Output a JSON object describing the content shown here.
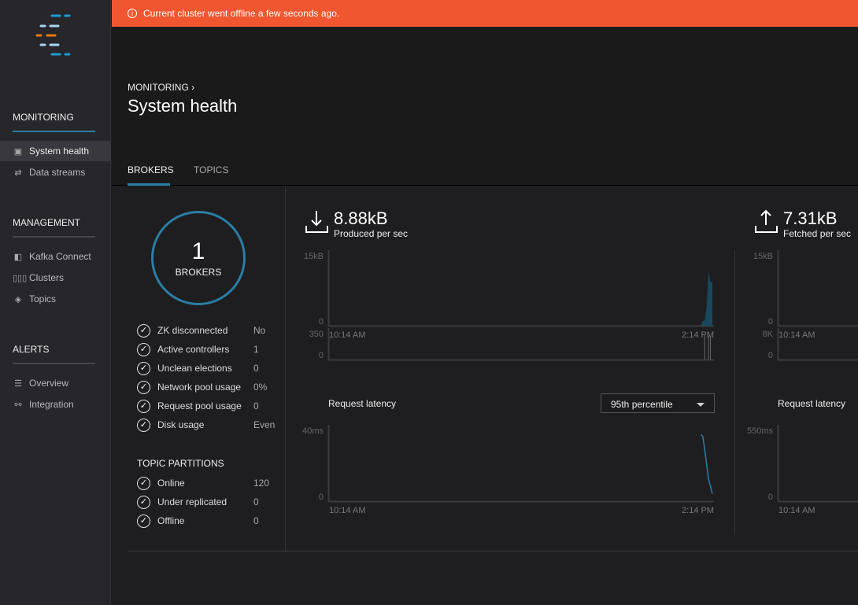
{
  "banner": {
    "text": "Current cluster went offline a few seconds ago.",
    "icon": "info-icon",
    "color": "#f0562f"
  },
  "sidebar": {
    "sections": [
      {
        "title": "MONITORING",
        "items": [
          {
            "label": "System health",
            "icon": "pulse-chart-icon",
            "active": true
          },
          {
            "label": "Data streams",
            "icon": "arrows-icon"
          }
        ]
      },
      {
        "title": "MANAGEMENT",
        "items": [
          {
            "label": "Kafka Connect",
            "icon": "connect-icon"
          },
          {
            "label": "Clusters",
            "icon": "clusters-icon"
          },
          {
            "label": "Topics",
            "icon": "layers-icon"
          }
        ]
      },
      {
        "title": "ALERTS",
        "items": [
          {
            "label": "Overview",
            "icon": "menu-icon"
          },
          {
            "label": "Integration",
            "icon": "integration-icon"
          }
        ]
      }
    ]
  },
  "header": {
    "breadcrumb": "MONITORING",
    "title": "System health"
  },
  "tabs": [
    {
      "label": "BROKERS",
      "active": true
    },
    {
      "label": "TOPICS"
    }
  ],
  "brokers": {
    "count": "1",
    "label": "BROKERS",
    "status": [
      {
        "label": "ZK disconnected",
        "value": "No"
      },
      {
        "label": "Active controllers",
        "value": "1"
      },
      {
        "label": "Unclean elections",
        "value": "0"
      },
      {
        "label": "Network pool usage",
        "value": "0%"
      },
      {
        "label": "Request pool usage",
        "value": "0"
      },
      {
        "label": "Disk usage",
        "value": "Even"
      }
    ],
    "partitions_title": "TOPIC PARTITIONS",
    "partitions": [
      {
        "label": "Online",
        "value": "120"
      },
      {
        "label": "Under replicated",
        "value": "0"
      },
      {
        "label": "Offline",
        "value": "0"
      }
    ]
  },
  "produced": {
    "value": "8.88kB",
    "label": "Produced per sec"
  },
  "fetched": {
    "value": "7.31kB",
    "label": "Fetched per sec"
  },
  "latency": {
    "label": "Request latency",
    "select": "95th percentile"
  },
  "accent": "#2a7ea5",
  "chart_data": [
    {
      "type": "area",
      "name": "produced-bytes",
      "ylim": [
        0,
        15
      ],
      "yticks": [
        "15kB",
        "0"
      ],
      "xticks": [
        "10:14 AM",
        "2:14 PM"
      ],
      "x": [
        0,
        0.97,
        0.975,
        0.98,
        0.985,
        0.99,
        0.995,
        1
      ],
      "values": [
        0,
        0,
        1,
        1,
        4,
        11,
        9,
        9
      ]
    },
    {
      "type": "bar",
      "name": "produced-requests",
      "ylim": [
        0,
        350
      ],
      "yticks": [
        "350",
        "0"
      ],
      "x": [
        0.98,
        0.99,
        0.995
      ],
      "values": [
        300,
        290,
        280
      ]
    },
    {
      "type": "line",
      "name": "produced-latency",
      "ylim": [
        0,
        40
      ],
      "yticks": [
        "40ms",
        "0"
      ],
      "xticks": [
        "10:14 AM",
        "2:14 PM"
      ],
      "x": [
        0.97,
        0.975,
        0.98,
        0.99,
        1
      ],
      "values": [
        36,
        35,
        28,
        12,
        4
      ]
    },
    {
      "type": "area",
      "name": "fetched-bytes",
      "ylim": [
        0,
        15
      ],
      "yticks": [
        "15kB",
        "0"
      ],
      "xticks": [
        "10:14 AM"
      ],
      "x": [],
      "values": []
    },
    {
      "type": "bar",
      "name": "fetched-requests",
      "ylim": [
        0,
        8
      ],
      "yticks": [
        "8K",
        "0"
      ],
      "x": [],
      "values": []
    },
    {
      "type": "line",
      "name": "fetched-latency",
      "ylim": [
        0,
        550
      ],
      "yticks": [
        "550ms",
        "0"
      ],
      "xticks": [
        "10:14 AM"
      ],
      "x": [],
      "values": []
    }
  ]
}
